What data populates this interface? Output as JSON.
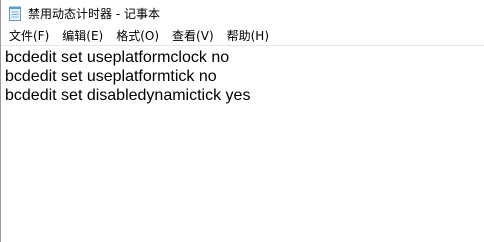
{
  "window": {
    "title": "禁用动态计时器 - 记事本"
  },
  "menu": {
    "items": [
      {
        "label": "文件(F)"
      },
      {
        "label": "编辑(E)"
      },
      {
        "label": "格式(O)"
      },
      {
        "label": "查看(V)"
      },
      {
        "label": "帮助(H)"
      }
    ]
  },
  "editor": {
    "lines": [
      "bcdedit set useplatformclock no",
      "bcdedit set useplatformtick no",
      "bcdedit set disabledynamictick yes"
    ]
  },
  "colors": {
    "icon_primary": "#5a9fd4",
    "icon_paper": "#e8f1fa"
  },
  "icons": {
    "app": "notepad-icon"
  }
}
